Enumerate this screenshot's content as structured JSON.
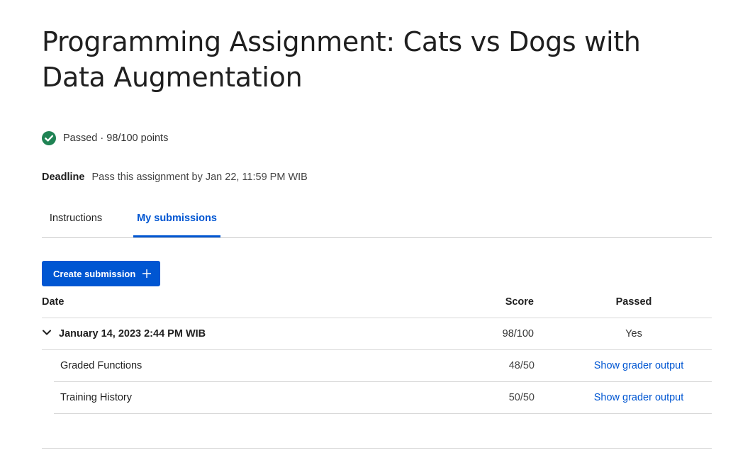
{
  "page": {
    "title": "Programming Assignment: Cats vs Dogs with Data Augmentation"
  },
  "status": {
    "icon": "check-circle-icon",
    "color": "#1f8354",
    "text": "Passed · 98/100 points"
  },
  "deadline": {
    "label": "Deadline",
    "text": "Pass this assignment by Jan 22, 11:59 PM WIB"
  },
  "tabs": [
    {
      "label": "Instructions",
      "active": false
    },
    {
      "label": "My submissions",
      "active": true
    }
  ],
  "accent_color": "#0056d2",
  "create_button": {
    "label": "Create submission",
    "icon": "plus-icon"
  },
  "table": {
    "headers": {
      "date": "Date",
      "score": "Score",
      "passed": "Passed"
    },
    "submission": {
      "date": "January 14, 2023 2:44 PM WIB",
      "score": "98/100",
      "passed": "Yes",
      "expanded": true,
      "parts": [
        {
          "name": "Graded Functions",
          "score": "48/50",
          "link": "Show grader output"
        },
        {
          "name": "Training History",
          "score": "50/50",
          "link": "Show grader output"
        }
      ]
    }
  }
}
